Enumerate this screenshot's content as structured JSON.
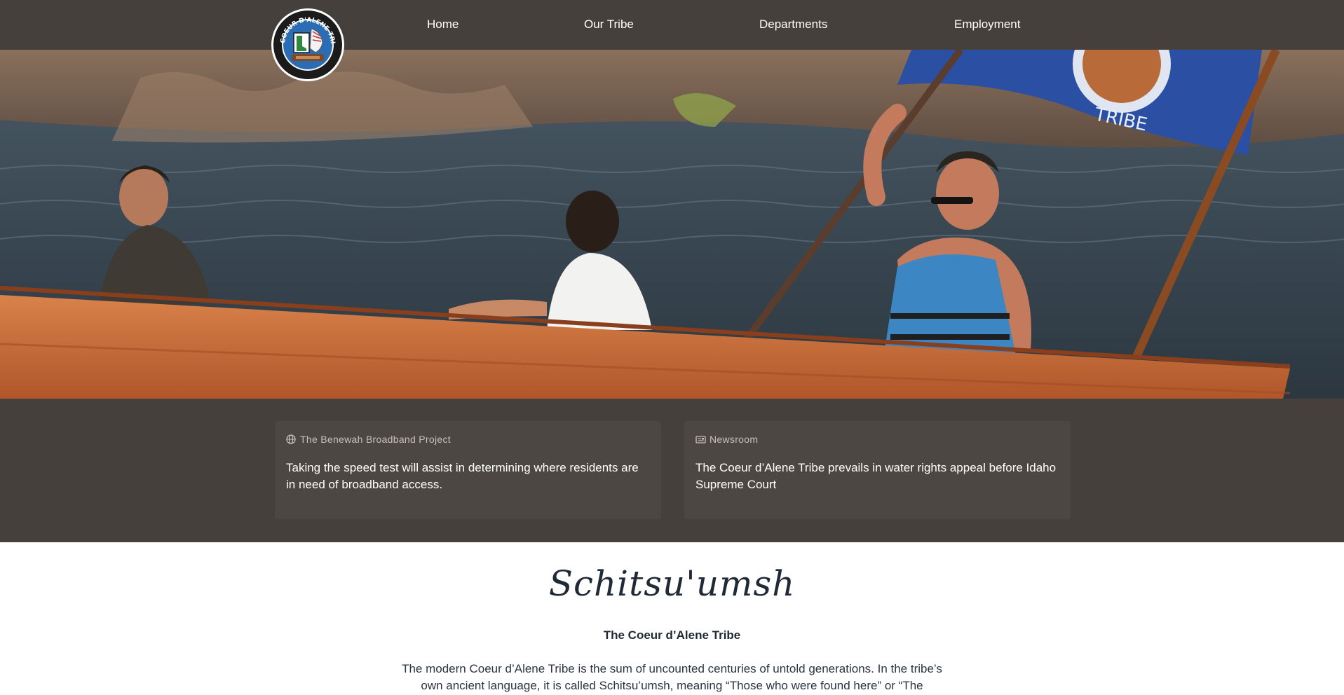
{
  "nav": {
    "logo_alt": "COEUR D'ALENE TRIBE",
    "items": [
      {
        "label": "Home"
      },
      {
        "label": "Our Tribe"
      },
      {
        "label": "Departments"
      },
      {
        "label": "Employment"
      }
    ]
  },
  "hero": {
    "flag_text": "TRIBE"
  },
  "news": {
    "cards": [
      {
        "icon": "globe-icon",
        "category": "The Benewah Broadband Project",
        "text": "Taking the speed test will assist in determining where residents are in need of broadband access."
      },
      {
        "icon": "newspaper-icon",
        "category": "Newsroom",
        "text": "The Coeur d’Alene Tribe prevails in water rights appeal before Idaho Supreme Court"
      }
    ]
  },
  "intro": {
    "title": "Schitsu'umsh",
    "subtitle": "The Coeur d’Alene Tribe",
    "paragraph": "The modern Coeur d’Alene Tribe is the sum of uncounted centuries of untold generations. In the tribe’s own ancient language, it is called Schitsu’umsh, meaning “Those who were found here” or “The"
  },
  "colors": {
    "nav_bg": "#45403c",
    "band_bg": "#45403c",
    "card_bg": "#4c4743",
    "text_dark": "#1f2a36"
  }
}
